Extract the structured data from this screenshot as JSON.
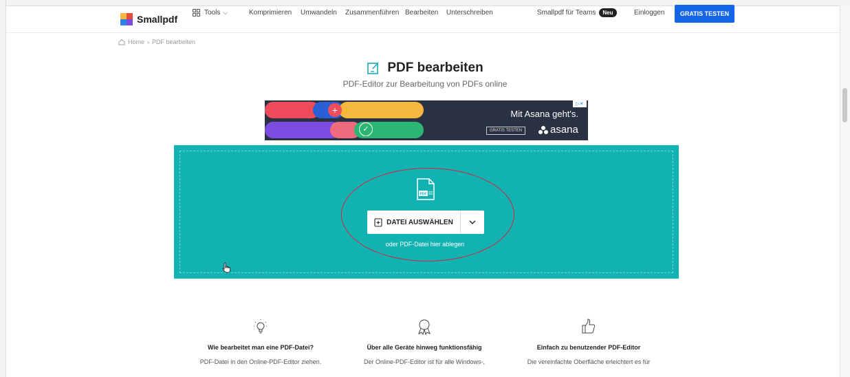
{
  "nav": {
    "brand": "Smallpdf",
    "tools_label": "Tools",
    "links": [
      "Komprimieren",
      "Umwandeln",
      "Zusammenführen",
      "Bearbeiten",
      "Unterschreiben"
    ],
    "teams_label": "Smallpdf für Teams",
    "teams_badge": "Neu",
    "login_label": "Einloggen",
    "cta_label": "GRATIS TESTEN"
  },
  "breadcrumb": {
    "home": "Home",
    "separator": "›",
    "current": "PDF bearbeiten"
  },
  "page": {
    "title": "PDF bearbeiten",
    "subtitle": "PDF-Editor zur Bearbeitung von PDFs online"
  },
  "ad": {
    "headline": "Mit Asana geht's.",
    "button": "GRATIS TESTEN",
    "brand": "asana"
  },
  "upload": {
    "choose_label": "DATEI AUSWÄHLEN",
    "drop_hint": "oder PDF-Datei hier ablegen",
    "file_icon_text": "PDF",
    "accent_color": "#12b2b3"
  },
  "features": [
    {
      "icon": "lightbulb-icon",
      "title": "Wie bearbeitet man eine PDF-Datei?",
      "text": "PDF-Datei in den Online-PDF-Editor ziehen."
    },
    {
      "icon": "award-icon",
      "title": "Über alle Geräte hinweg funktionsfähig",
      "text": "Der Online-PDF-Editor ist für alle Windows-,"
    },
    {
      "icon": "thumbs-up-icon",
      "title": "Einfach zu benutzender PDF-Editor",
      "text": "Die vereinfachte Oberfläche erleichtert es für"
    }
  ]
}
